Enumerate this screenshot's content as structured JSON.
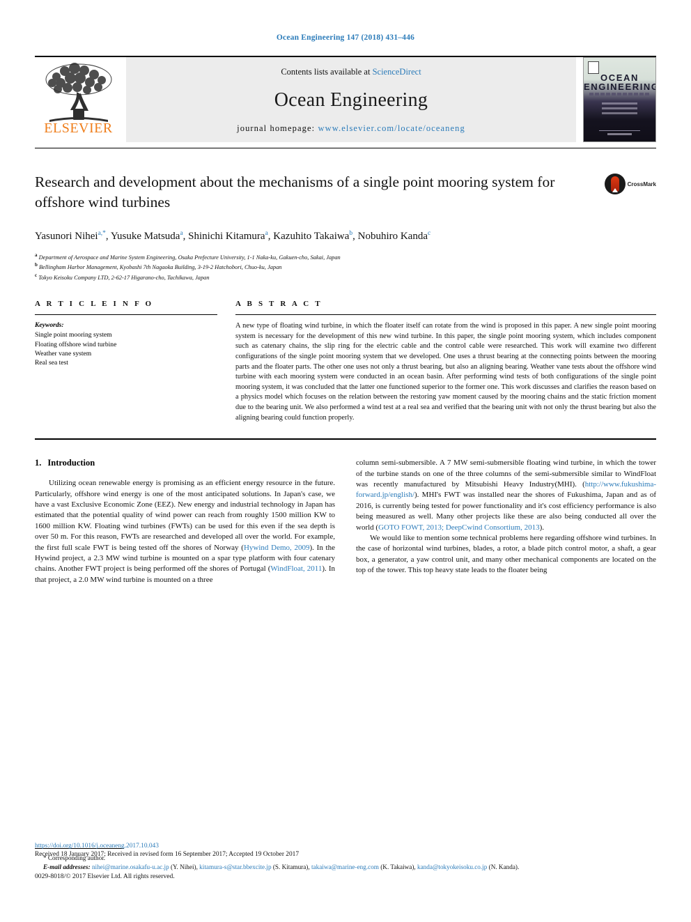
{
  "running_head": "Ocean Engineering 147 (2018) 431–446",
  "masthead": {
    "publisher_logo_text": "ELSEVIER",
    "contents_prefix": "Contents lists available at ",
    "contents_link": "ScienceDirect",
    "journal_name": "Ocean Engineering",
    "homepage_prefix": "journal homepage: ",
    "homepage_url": "www.elsevier.com/locate/oceaneng",
    "cover": {
      "title_line1": "OCEAN",
      "title_line2": "ENGINEERING"
    }
  },
  "article": {
    "title": "Research and development about the mechanisms of a single point mooring system for offshore wind turbines",
    "crossmark_label": "CrossMark",
    "authors": [
      {
        "name": "Yasunori Nihei",
        "marks": "a,*"
      },
      {
        "name": "Yusuke Matsuda",
        "marks": "a"
      },
      {
        "name": "Shinichi Kitamura",
        "marks": "a"
      },
      {
        "name": "Kazuhito Takaiwa",
        "marks": "b"
      },
      {
        "name": "Nobuhiro Kanda",
        "marks": "c"
      }
    ],
    "affiliations": [
      {
        "mark": "a",
        "text": "Department of Aerospace and Marine System Engineering, Osaka Prefecture University, 1-1 Naka-ku, Gakuen-cho, Sakai, Japan"
      },
      {
        "mark": "b",
        "text": "Bellingham Harbor Management, Kyobashi 7th Nagaoka Building, 3-19-2 Hatchobori, Chuo-ku, Japan"
      },
      {
        "mark": "c",
        "text": "Tokyo Keisoku Company LTD, 2-62-17 Higarano-cho, Tachikawa, Japan"
      }
    ]
  },
  "article_info": {
    "heading": "A R T I C L E   I N F O",
    "keywords_label": "Keywords:",
    "keywords": [
      "Single point mooring system",
      "Floating offshore wind turbine",
      "Weather vane system",
      "Real sea test"
    ]
  },
  "abstract": {
    "heading": "A B S T R A C T",
    "text": "A new type of floating wind turbine, in which the floater itself can rotate from the wind is proposed in this paper. A new single point mooring system is necessary for the development of this new wind turbine. In this paper, the single point mooring system, which includes component such as catenary chains, the slip ring for the electric cable and the control cable were researched. This work will examine two different configurations of the single point mooring system that we developed. One uses a thrust bearing at the connecting points between the mooring parts and the floater parts. The other one uses not only a thrust bearing, but also an aligning bearing. Weather vane tests about the offshore wind turbine with each mooring system were conducted in an ocean basin. After performing wind tests of both configurations of the single point mooring system, it was concluded that the latter one functioned superior to the former one. This work discusses and clarifies the reason based on a physics model which focuses on the relation between the restoring yaw moment caused by the mooring chains and the static friction moment due to the bearing unit. We also performed a wind test at a real sea and verified that the bearing unit with not only the thrust bearing but also the aligning bearing could function properly."
  },
  "introduction": {
    "number": "1.",
    "title": "Introduction",
    "left_paragraph_part1": "Utilizing ocean renewable energy is promising as an efficient energy resource in the future. Particularly, offshore wind energy is one of the most anticipated solutions. In Japan's case, we have a vast Exclusive Economic Zone (EEZ). New energy and industrial technology in Japan has estimated that the potential quality of wind power can reach from roughly 1500 million KW to 1600 million KW. Floating wind turbines (FWTs) can be used for this even if the sea depth is over 50 m. For this reason, FWTs are researched and developed all over the world. For example, the first full scale FWT is being tested off the shores of Norway (",
    "cite_hywind": "Hywind Demo, 2009",
    "left_paragraph_part2": "). In the Hywind project, a 2.3 MW wind turbine is mounted on a spar type platform with four catenary chains. Another FWT project is being performed off the shores of Portugal (",
    "cite_windfloat": "WindFloat, 2011",
    "left_paragraph_part3": "). In that project, a 2.0 MW wind turbine is mounted on a three",
    "right_paragraph_part1": "column semi-submersible. A 7 MW semi-submersible floating wind turbine, in which the tower of the turbine stands on one of the three columns of the semi-submersible similar to WindFloat was recently manufactured by Mitsubishi Heavy Industry(MHI). (",
    "cite_fukushima": "http://www.fukushima-forward.jp/english/",
    "right_paragraph_part2": "). MHI's FWT was installed near the shores of Fukushima, Japan and as of 2016, is currently being tested for power functionality and it's cost efficiency performance is also being measured as well. Many other projects like these are also being conducted all over the world (",
    "cite_goto": "GOTO FOWT, 2013; DeepCwind Consortium, 2013",
    "right_paragraph_part3": ").",
    "right_paragraph2": "We would like to mention some technical problems here regarding offshore wind turbines. In the case of horizontal wind turbines, blades, a rotor, a blade pitch control motor, a shaft, a gear box, a generator, a yaw control unit, and many other mechanical components are located on the top of the tower. This top heavy state leads to the floater being"
  },
  "footnotes": {
    "corresponding": "* Corresponding author.",
    "email_label": "E-mail addresses:",
    "emails": [
      {
        "address": "nihei@marine.osakafu-u.ac.jp",
        "person": "(Y. Nihei),"
      },
      {
        "address": "kitamura-s@star.bbexcite.jp",
        "person": "(S. Kitamura),"
      },
      {
        "address": "takaiwa@marine-eng.com",
        "person": "(K. Takaiwa),"
      },
      {
        "address": "kanda@tokyokeisoku.co.jp",
        "person": "(N. Kanda)."
      }
    ]
  },
  "publication": {
    "doi": "https://doi.org/10.1016/j.oceaneng.2017.10.043",
    "dates": "Received 18 January 2017; Received in revised form 16 September 2017; Accepted 19 October 2017",
    "copyright": "0029-8018/© 2017 Elsevier Ltd. All rights reserved."
  },
  "colors": {
    "link_blue": "#2b7bb9",
    "elsevier_orange": "#ef7d1a",
    "masthead_grey": "#ececec"
  }
}
